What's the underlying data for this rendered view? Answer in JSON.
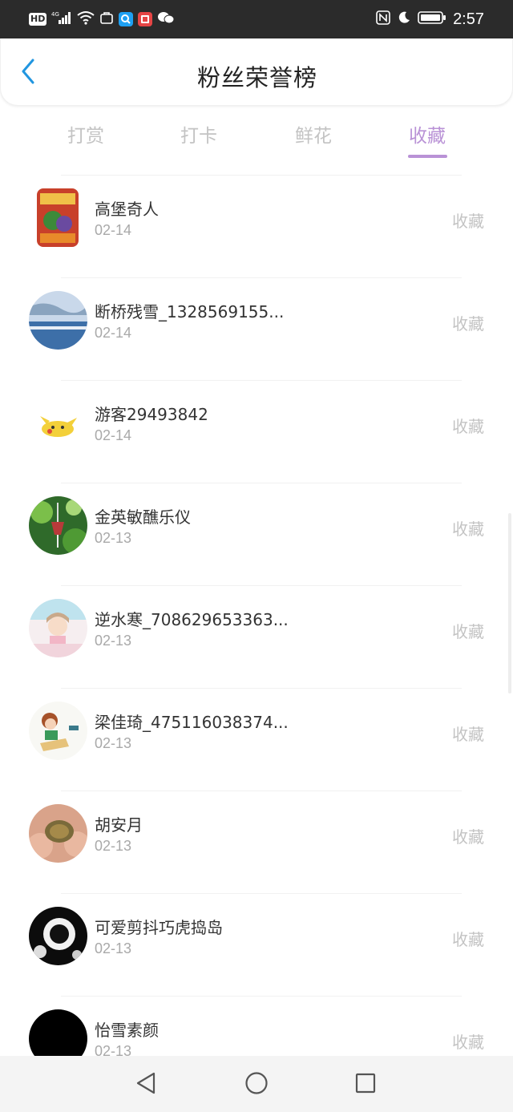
{
  "status_bar": {
    "time": "2:57",
    "network": "4G",
    "hd_label": "HD"
  },
  "header": {
    "title": "粉丝荣誉榜"
  },
  "tabs": [
    {
      "label": "打赏",
      "active": false
    },
    {
      "label": "打卡",
      "active": false
    },
    {
      "label": "鲜花",
      "active": false
    },
    {
      "label": "收藏",
      "active": true
    }
  ],
  "accent_color": "#b992d6",
  "list": [
    {
      "name": "高堡奇人",
      "date": "02-14",
      "action": "收藏",
      "avatar": "book-cover-avatar"
    },
    {
      "name": "断桥残雪_1328569155...",
      "date": "02-14",
      "action": "收藏",
      "avatar": "lake-avatar"
    },
    {
      "name": "游客29493842",
      "date": "02-14",
      "action": "收藏",
      "avatar": "pikachu-avatar"
    },
    {
      "name": "金英敏醮乐仪",
      "date": "02-13",
      "action": "收藏",
      "avatar": "windchime-avatar"
    },
    {
      "name": "逆水寒_708629653363...",
      "date": "02-13",
      "action": "收藏",
      "avatar": "anime-girl-avatar"
    },
    {
      "name": "梁佳琦_475116038374...",
      "date": "02-13",
      "action": "收藏",
      "avatar": "reading-girl-avatar"
    },
    {
      "name": "胡安月",
      "date": "02-13",
      "action": "收藏",
      "avatar": "turtle-avatar"
    },
    {
      "name": "可爱剪抖巧虎捣岛",
      "date": "02-13",
      "action": "收藏",
      "avatar": "bw-animal-avatar"
    },
    {
      "name": "怡雪素颜",
      "date": "02-13",
      "action": "收藏",
      "avatar": "black-avatar"
    }
  ]
}
